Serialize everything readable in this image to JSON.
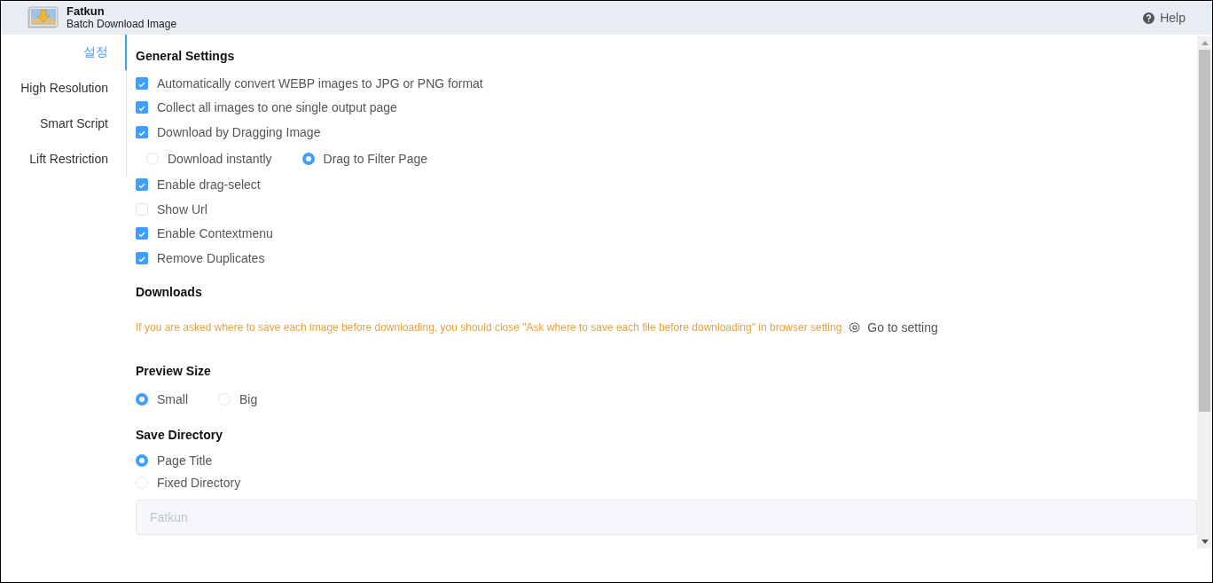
{
  "header": {
    "app_name": "Fatkun",
    "subtitle": "Batch Download Image",
    "help": "Help"
  },
  "sidebar": {
    "items": [
      {
        "label": "설정",
        "selected": true
      },
      {
        "label": "High Resolution",
        "selected": false
      },
      {
        "label": "Smart Script",
        "selected": false
      },
      {
        "label": "Lift Restriction",
        "selected": false
      }
    ]
  },
  "sections": [
    {
      "title": "General Settings",
      "rows": [
        {
          "kind": "checkbox",
          "label": "Automatically convert WEBP images to JPG or PNG format",
          "checked": true
        },
        {
          "kind": "checkbox",
          "label": "Collect all images to one single output page",
          "checked": true
        },
        {
          "kind": "checkbox",
          "label": "Download by Dragging Image",
          "checked": true
        },
        {
          "kind": "radio_row",
          "indented": true,
          "options": [
            {
              "label": "Download instantly",
              "selected": false
            },
            {
              "label": "Drag to Filter Page",
              "selected": true
            }
          ]
        },
        {
          "kind": "checkbox",
          "label": "Enable drag-select",
          "checked": true
        },
        {
          "kind": "checkbox",
          "label": "Show Url",
          "checked": false
        },
        {
          "kind": "checkbox",
          "label": "Enable Contextmenu",
          "checked": true
        },
        {
          "kind": "checkbox",
          "label": "Remove Duplicates",
          "checked": true
        }
      ]
    },
    {
      "title": "Downloads",
      "rows": [
        {
          "kind": "note",
          "text": "If you are asked where to save each image before downloading, you should close \"Ask where to save each file before downloading\" in browser setting",
          "link": "Go to setting"
        }
      ]
    },
    {
      "title": "Preview Size",
      "rows": [
        {
          "kind": "radio_row",
          "indented": false,
          "options": [
            {
              "label": "Small",
              "selected": true
            },
            {
              "label": "Big",
              "selected": false
            }
          ]
        }
      ]
    },
    {
      "title": "Save Directory",
      "rows": [
        {
          "kind": "radio_column",
          "options": [
            {
              "label": "Page Title",
              "selected": true
            },
            {
              "label": "Fixed Directory",
              "selected": false
            }
          ]
        },
        {
          "kind": "field",
          "placeholder": "Fatkun"
        }
      ]
    }
  ]
}
